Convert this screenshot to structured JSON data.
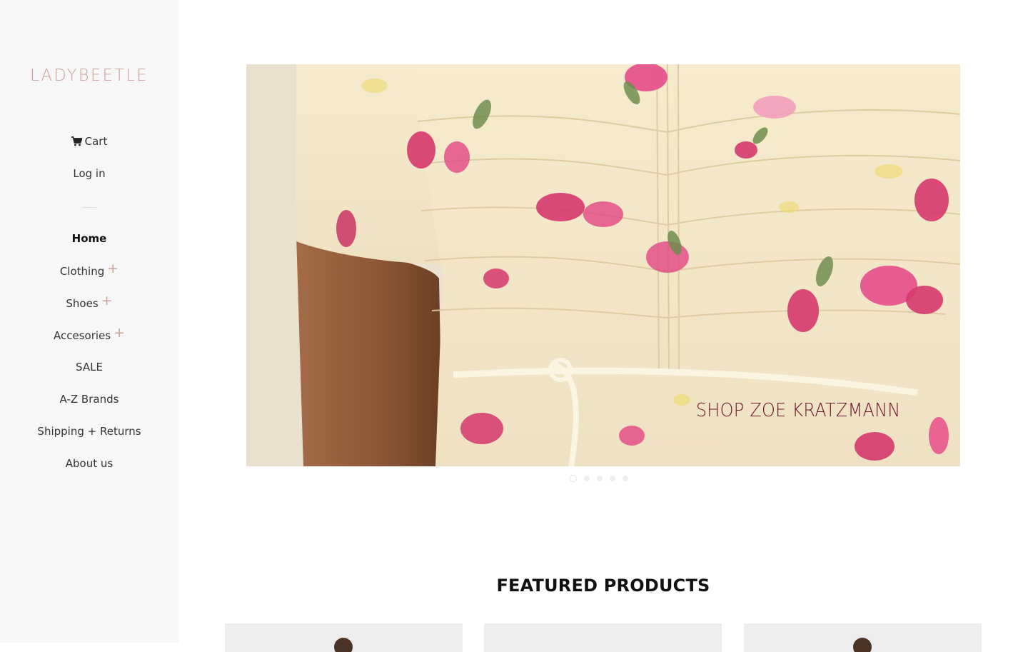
{
  "brand": {
    "logo": "LADYBEETLE",
    "color": "#c9a39a"
  },
  "account": {
    "cart_label": "Cart",
    "cart_icon": "cart-icon",
    "login_label": "Log in"
  },
  "nav": {
    "items": [
      {
        "label": "Home",
        "active": true
      },
      {
        "label": "Clothing",
        "expandable": true
      },
      {
        "label": "Shoes",
        "expandable": true
      },
      {
        "label": "Accesories",
        "expandable": true
      },
      {
        "label": "SALE"
      },
      {
        "label": "A-Z Brands"
      },
      {
        "label": "Shipping + Returns"
      },
      {
        "label": "About us"
      }
    ],
    "expand_symbol": "+"
  },
  "hero": {
    "caption": "SHOP ZOE KRATZMANN",
    "caption_color": "#6b1328",
    "slide_count": 5,
    "active_slide": 1
  },
  "featured": {
    "title": "FEATURED PRODUCTS"
  }
}
